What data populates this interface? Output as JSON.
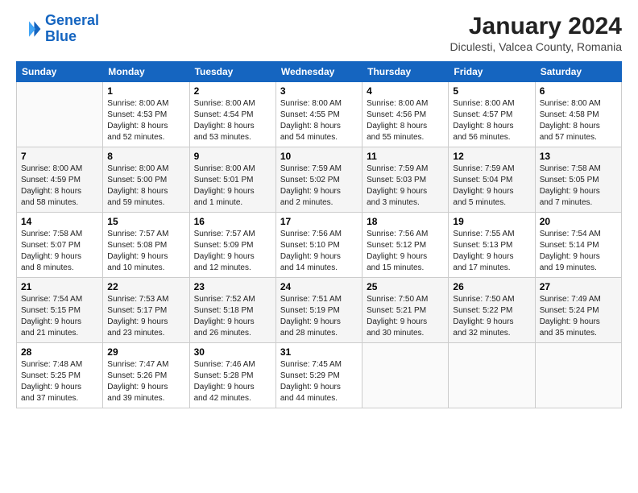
{
  "logo": {
    "line1": "General",
    "line2": "Blue"
  },
  "title": "January 2024",
  "subtitle": "Diculesti, Valcea County, Romania",
  "headers": [
    "Sunday",
    "Monday",
    "Tuesday",
    "Wednesday",
    "Thursday",
    "Friday",
    "Saturday"
  ],
  "weeks": [
    [
      {
        "num": "",
        "info": ""
      },
      {
        "num": "1",
        "info": "Sunrise: 8:00 AM\nSunset: 4:53 PM\nDaylight: 8 hours\nand 52 minutes."
      },
      {
        "num": "2",
        "info": "Sunrise: 8:00 AM\nSunset: 4:54 PM\nDaylight: 8 hours\nand 53 minutes."
      },
      {
        "num": "3",
        "info": "Sunrise: 8:00 AM\nSunset: 4:55 PM\nDaylight: 8 hours\nand 54 minutes."
      },
      {
        "num": "4",
        "info": "Sunrise: 8:00 AM\nSunset: 4:56 PM\nDaylight: 8 hours\nand 55 minutes."
      },
      {
        "num": "5",
        "info": "Sunrise: 8:00 AM\nSunset: 4:57 PM\nDaylight: 8 hours\nand 56 minutes."
      },
      {
        "num": "6",
        "info": "Sunrise: 8:00 AM\nSunset: 4:58 PM\nDaylight: 8 hours\nand 57 minutes."
      }
    ],
    [
      {
        "num": "7",
        "info": "Sunrise: 8:00 AM\nSunset: 4:59 PM\nDaylight: 8 hours\nand 58 minutes."
      },
      {
        "num": "8",
        "info": "Sunrise: 8:00 AM\nSunset: 5:00 PM\nDaylight: 8 hours\nand 59 minutes."
      },
      {
        "num": "9",
        "info": "Sunrise: 8:00 AM\nSunset: 5:01 PM\nDaylight: 9 hours\nand 1 minute."
      },
      {
        "num": "10",
        "info": "Sunrise: 7:59 AM\nSunset: 5:02 PM\nDaylight: 9 hours\nand 2 minutes."
      },
      {
        "num": "11",
        "info": "Sunrise: 7:59 AM\nSunset: 5:03 PM\nDaylight: 9 hours\nand 3 minutes."
      },
      {
        "num": "12",
        "info": "Sunrise: 7:59 AM\nSunset: 5:04 PM\nDaylight: 9 hours\nand 5 minutes."
      },
      {
        "num": "13",
        "info": "Sunrise: 7:58 AM\nSunset: 5:05 PM\nDaylight: 9 hours\nand 7 minutes."
      }
    ],
    [
      {
        "num": "14",
        "info": "Sunrise: 7:58 AM\nSunset: 5:07 PM\nDaylight: 9 hours\nand 8 minutes."
      },
      {
        "num": "15",
        "info": "Sunrise: 7:57 AM\nSunset: 5:08 PM\nDaylight: 9 hours\nand 10 minutes."
      },
      {
        "num": "16",
        "info": "Sunrise: 7:57 AM\nSunset: 5:09 PM\nDaylight: 9 hours\nand 12 minutes."
      },
      {
        "num": "17",
        "info": "Sunrise: 7:56 AM\nSunset: 5:10 PM\nDaylight: 9 hours\nand 14 minutes."
      },
      {
        "num": "18",
        "info": "Sunrise: 7:56 AM\nSunset: 5:12 PM\nDaylight: 9 hours\nand 15 minutes."
      },
      {
        "num": "19",
        "info": "Sunrise: 7:55 AM\nSunset: 5:13 PM\nDaylight: 9 hours\nand 17 minutes."
      },
      {
        "num": "20",
        "info": "Sunrise: 7:54 AM\nSunset: 5:14 PM\nDaylight: 9 hours\nand 19 minutes."
      }
    ],
    [
      {
        "num": "21",
        "info": "Sunrise: 7:54 AM\nSunset: 5:15 PM\nDaylight: 9 hours\nand 21 minutes."
      },
      {
        "num": "22",
        "info": "Sunrise: 7:53 AM\nSunset: 5:17 PM\nDaylight: 9 hours\nand 23 minutes."
      },
      {
        "num": "23",
        "info": "Sunrise: 7:52 AM\nSunset: 5:18 PM\nDaylight: 9 hours\nand 26 minutes."
      },
      {
        "num": "24",
        "info": "Sunrise: 7:51 AM\nSunset: 5:19 PM\nDaylight: 9 hours\nand 28 minutes."
      },
      {
        "num": "25",
        "info": "Sunrise: 7:50 AM\nSunset: 5:21 PM\nDaylight: 9 hours\nand 30 minutes."
      },
      {
        "num": "26",
        "info": "Sunrise: 7:50 AM\nSunset: 5:22 PM\nDaylight: 9 hours\nand 32 minutes."
      },
      {
        "num": "27",
        "info": "Sunrise: 7:49 AM\nSunset: 5:24 PM\nDaylight: 9 hours\nand 35 minutes."
      }
    ],
    [
      {
        "num": "28",
        "info": "Sunrise: 7:48 AM\nSunset: 5:25 PM\nDaylight: 9 hours\nand 37 minutes."
      },
      {
        "num": "29",
        "info": "Sunrise: 7:47 AM\nSunset: 5:26 PM\nDaylight: 9 hours\nand 39 minutes."
      },
      {
        "num": "30",
        "info": "Sunrise: 7:46 AM\nSunset: 5:28 PM\nDaylight: 9 hours\nand 42 minutes."
      },
      {
        "num": "31",
        "info": "Sunrise: 7:45 AM\nSunset: 5:29 PM\nDaylight: 9 hours\nand 44 minutes."
      },
      {
        "num": "",
        "info": ""
      },
      {
        "num": "",
        "info": ""
      },
      {
        "num": "",
        "info": ""
      }
    ]
  ]
}
